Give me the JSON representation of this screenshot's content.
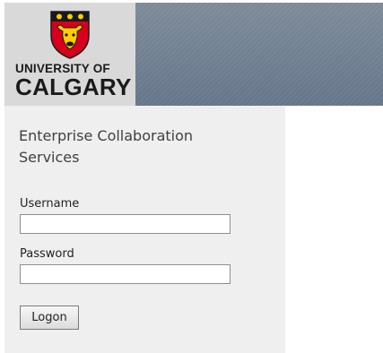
{
  "logo": {
    "line1": "UNIVERSITY OF",
    "line2": "CALGARY"
  },
  "form": {
    "title": "Enterprise Collaboration Services",
    "username_label": "Username",
    "username_value": "",
    "password_label": "Password",
    "password_value": "",
    "logon_label": "Logon"
  },
  "colors": {
    "banner": "#6d7c8b",
    "logo_background": "#d9d9d9",
    "panel_background": "#efefef",
    "crest_red": "#d6001c",
    "crest_gold": "#ffcd00"
  },
  "icons": {
    "crest": "university-crest-icon"
  }
}
